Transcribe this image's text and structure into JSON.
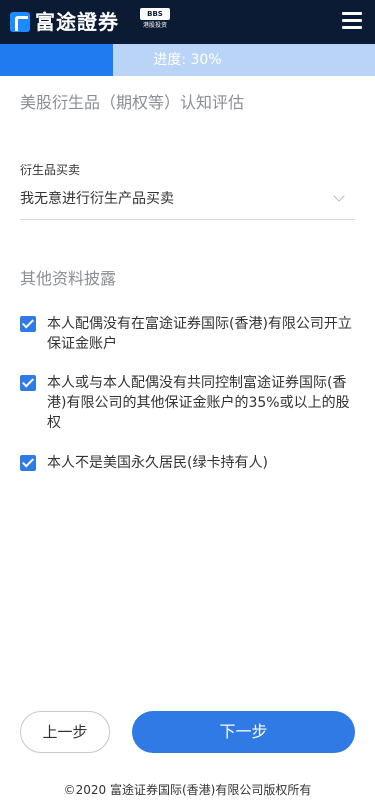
{
  "header": {
    "logo_text": "富途證券",
    "badge_top": "BBS",
    "badge_bottom": "港股投资",
    "menu_icon": "hamburger-menu-icon"
  },
  "progress": {
    "label": "进度: 30%",
    "value": 0.3
  },
  "page": {
    "heading": "美股衍生品（期权等）认知评估"
  },
  "derivatives_field": {
    "label": "衍生品买卖",
    "value": "我无意进行衍生产品买卖"
  },
  "disclosure": {
    "title": "其他资料披露",
    "items": [
      {
        "text": "本人配偶没有在富途证券国际(香港)有限公司开立保证金账户",
        "checked": true
      },
      {
        "text": "本人或与本人配偶没有共同控制富途证券国际(香港)有限公司的其他保证金账户的35%或以上的股权",
        "checked": true
      },
      {
        "text": "本人不是美国永久居民(绿卡持有人)",
        "checked": true
      }
    ]
  },
  "buttons": {
    "prev": "上一步",
    "next": "下一步"
  },
  "footer": {
    "copyright": "©2020 富途证券国际(香港)有限公司版权所有"
  },
  "colors": {
    "topbar": "#0a1b33",
    "accent": "#2f7ae5",
    "progress_fill": "#1f7bef",
    "progress_track": "#b9d4f6"
  }
}
